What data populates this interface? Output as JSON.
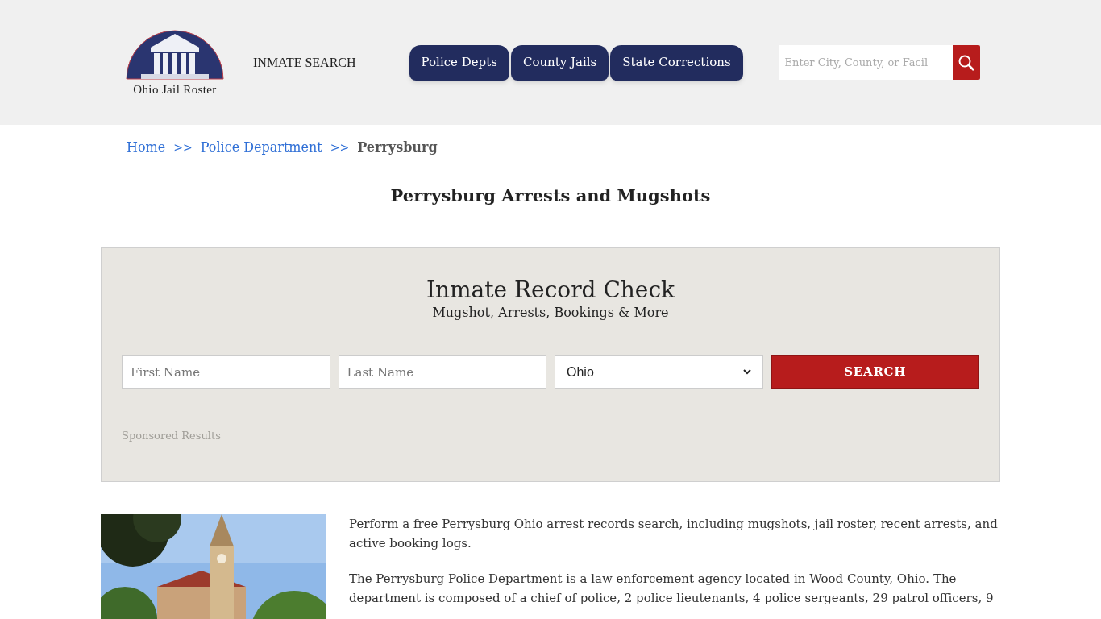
{
  "header": {
    "logo_text": "Ohio Jail Roster",
    "inmate_search_link": "INMATE SEARCH",
    "nav_tabs": [
      {
        "label": "Police Depts"
      },
      {
        "label": "County Jails"
      },
      {
        "label": "State Corrections"
      }
    ],
    "search": {
      "placeholder": "Enter City, County, or Facil"
    }
  },
  "breadcrumb": [
    {
      "label": "Home",
      "kind": "link"
    },
    {
      "label": ">>",
      "kind": "separator"
    },
    {
      "label": "Police Department",
      "kind": "link"
    },
    {
      "label": ">>",
      "kind": "separator"
    },
    {
      "label": "Perrysburg",
      "kind": "current"
    }
  ],
  "page_title": "Perrysburg Arrests and Mugshots",
  "record_check": {
    "title": "Inmate Record Check",
    "subtitle": "Mugshot, Arrests, Bookings & More",
    "first_name": {
      "placeholder": "First Name"
    },
    "last_name": {
      "placeholder": "Last Name"
    },
    "state_select": {
      "value": "Ohio"
    },
    "search_button": "SEARCH",
    "sponsored": "Sponsored Results"
  },
  "article": {
    "image": {
      "kind": "picture"
    },
    "paragraphs": [
      "Perform a free Perrysburg Ohio arrest records search, including mugshots, jail roster, recent arrests, and active booking logs.",
      "The Perrysburg Police Department is a law enforcement agency located in Wood County, Ohio. The department is composed of a chief of police, 2 police lieutenants, 4 police sergeants, 29 patrol officers, 9"
    ]
  }
}
